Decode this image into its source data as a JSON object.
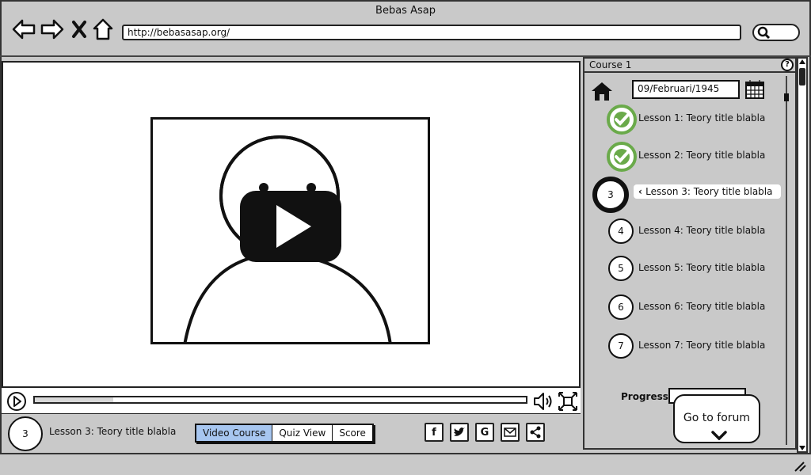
{
  "window": {
    "title": "Bebas Asap"
  },
  "browser": {
    "url": "http://bebasasap.org/",
    "nav_icons": [
      "back-arrow-icon",
      "forward-arrow-icon",
      "close-x-icon",
      "home-outline-icon"
    ],
    "search_icon": "magnifier-icon"
  },
  "video": {
    "progress_fraction": 0.16,
    "icons": [
      "play-circle-icon",
      "volume-icon",
      "fullscreen-icon"
    ]
  },
  "lesson_bar": {
    "current_number": "3",
    "current_title": "Lesson 3: Teory title blabla",
    "tabs": [
      {
        "label": "Video Course",
        "active": true
      },
      {
        "label": "Quiz View",
        "active": false
      },
      {
        "label": "Score",
        "active": false
      }
    ],
    "social_icons": [
      "facebook-icon",
      "twitter-icon",
      "google-icon",
      "mail-icon",
      "share-icon"
    ]
  },
  "sidebar": {
    "header": "Course 1",
    "help_icon": "?",
    "date_value": "09/Februari/1945",
    "lessons": [
      {
        "number": "1",
        "label": "Lesson 1: Teory title blabla",
        "status": "done"
      },
      {
        "number": "2",
        "label": "Lesson 2: Teory title blabla",
        "status": "done"
      },
      {
        "number": "3",
        "label": "Lesson 3: Teory title blabla",
        "status": "current"
      },
      {
        "number": "4",
        "label": "Lesson 4: Teory title blabla",
        "status": "todo"
      },
      {
        "number": "5",
        "label": "Lesson 5: Teory title blabla",
        "status": "todo"
      },
      {
        "number": "6",
        "label": "Lesson 6: Teory title blabla",
        "status": "todo"
      },
      {
        "number": "7",
        "label": "Lesson 7: Teory title blabla",
        "status": "todo"
      }
    ],
    "progress_label": "Progress",
    "forum_button": "Go to forum"
  },
  "colors": {
    "done": "#6aaa4a",
    "active_tab": "#a7c6f0",
    "chrome": "#c9c9c9"
  }
}
